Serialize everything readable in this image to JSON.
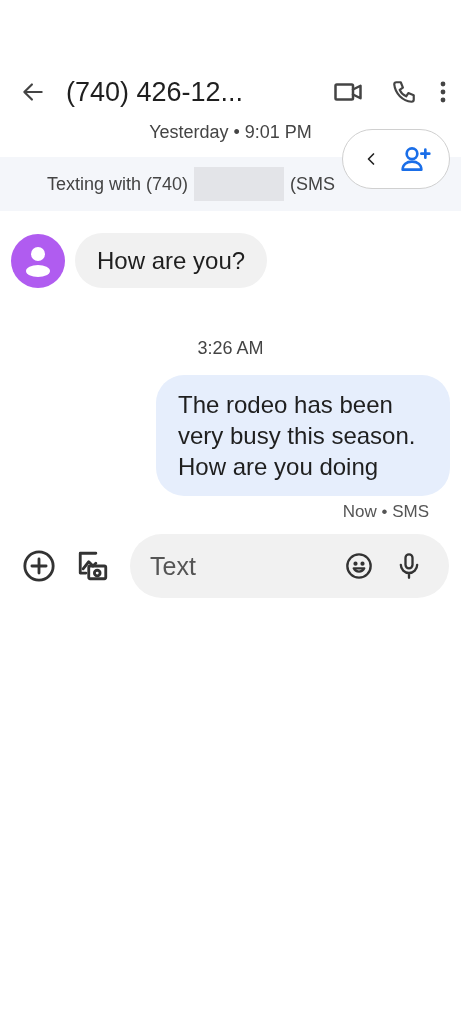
{
  "header": {
    "title": "(740) 426-12..."
  },
  "date_label": "Yesterday • 9:01 PM",
  "banner": {
    "prefix": "Texting with (740)",
    "suffix": "(SMS"
  },
  "messages": [
    {
      "kind": "incoming",
      "text": "How are you?"
    },
    {
      "kind": "time",
      "text": "3:26 AM"
    },
    {
      "kind": "outgoing",
      "text": "The rodeo has been very busy this season. How are you doing",
      "status": "Now • SMS"
    }
  ],
  "composer": {
    "placeholder": "Text"
  }
}
